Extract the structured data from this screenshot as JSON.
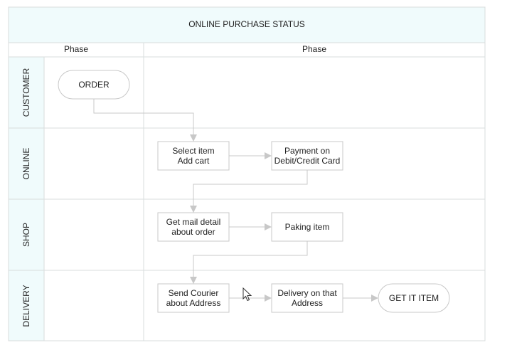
{
  "title": "ONLINE PURCHASE STATUS",
  "phases": [
    "Phase",
    "Phase"
  ],
  "lanes": [
    "CUSTOMER",
    "ONLINE",
    "SHOP",
    "DELIVERY"
  ],
  "nodes": {
    "order": {
      "lines": [
        "ORDER"
      ]
    },
    "select_item": {
      "lines": [
        "Select item",
        "Add cart"
      ]
    },
    "payment": {
      "lines": [
        "Payment on",
        "Debit/Credit Card"
      ]
    },
    "mail_detail": {
      "lines": [
        "Get mail detail",
        "about order"
      ]
    },
    "paking": {
      "lines": [
        "Paking item"
      ]
    },
    "courier": {
      "lines": [
        "Send Courier",
        "about Address"
      ]
    },
    "delivery": {
      "lines": [
        "Delivery on that",
        "Address"
      ]
    },
    "get_item": {
      "lines": [
        "GET IT ITEM"
      ]
    }
  },
  "colors": {
    "header_bg": "#f0fbfc",
    "border": "#d9dddd",
    "node_border": "#c8c8c8",
    "connector": "#c8c8c8"
  }
}
